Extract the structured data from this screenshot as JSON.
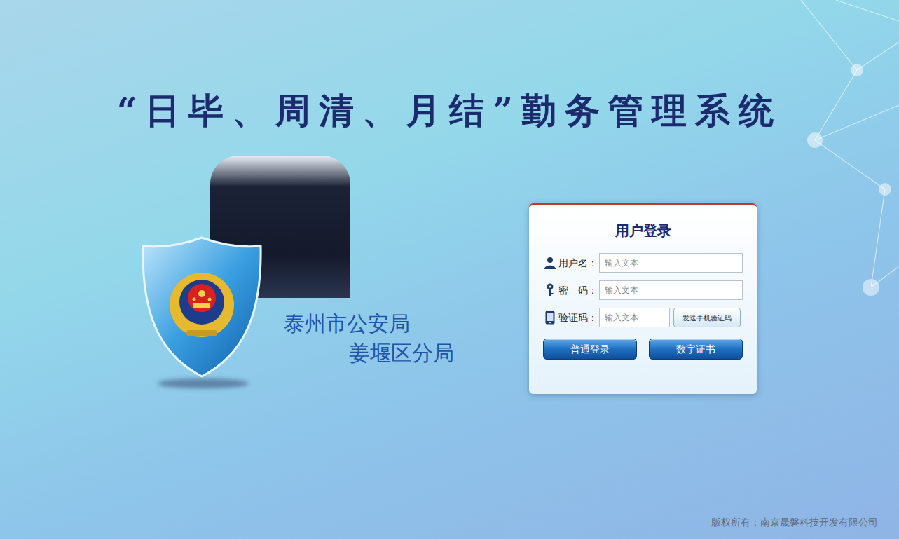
{
  "title": "“日毕、周清、月结”勤务管理系统",
  "organization": {
    "city": "泰州市公安局",
    "branch": "姜堰区分局"
  },
  "login": {
    "heading": "用户登录",
    "fields": [
      {
        "kind": "user",
        "label": "用户名：",
        "placeholder": "输入文本"
      },
      {
        "kind": "password",
        "label": "密　码：",
        "placeholder": "输入文本"
      },
      {
        "kind": "captcha",
        "label": "验证码：",
        "placeholder": "输入文本",
        "button": "发送手机验证码"
      }
    ],
    "buttons": [
      "普通登录",
      "数字证书"
    ]
  },
  "footer": "版权所有：南京晟磐科技开发有限公司"
}
